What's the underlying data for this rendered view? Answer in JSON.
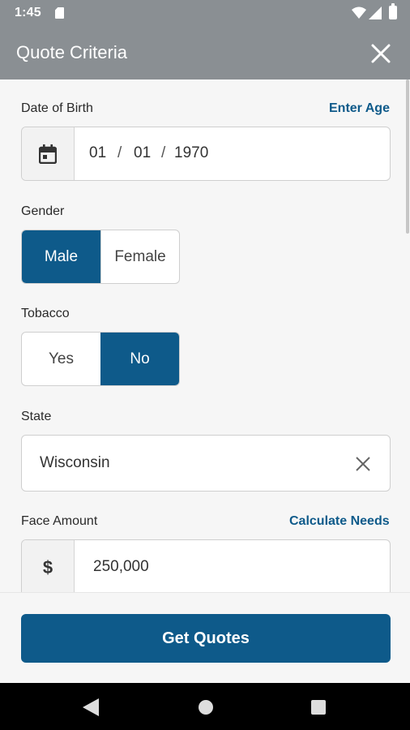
{
  "status_bar": {
    "time": "1:45",
    "icons": [
      "sd-card-icon",
      "wifi-icon",
      "signal-icon",
      "battery-icon"
    ]
  },
  "app_bar": {
    "title": "Quote Criteria",
    "close_icon": "close-icon"
  },
  "dob": {
    "label": "Date of Birth",
    "link": "Enter Age",
    "icon": "calendar-icon",
    "month": "01",
    "day": "01",
    "year": "1970",
    "separator": "/"
  },
  "gender": {
    "label": "Gender",
    "options": [
      "Male",
      "Female"
    ],
    "selected": "Male"
  },
  "tobacco": {
    "label": "Tobacco",
    "options": [
      "Yes",
      "No"
    ],
    "selected": "No"
  },
  "state": {
    "label": "State",
    "value": "Wisconsin",
    "clear_icon": "clear-icon"
  },
  "face_amount": {
    "label": "Face Amount",
    "link": "Calculate Needs",
    "prefix": "$",
    "value": "250,000"
  },
  "footer": {
    "button_label": "Get Quotes"
  },
  "nav_bar": {
    "icons": [
      "back-icon",
      "home-icon",
      "recents-icon"
    ]
  },
  "colors": {
    "accent": "#0e5a8a",
    "app_bar": "#8a8f93",
    "background": "#f6f6f6"
  }
}
